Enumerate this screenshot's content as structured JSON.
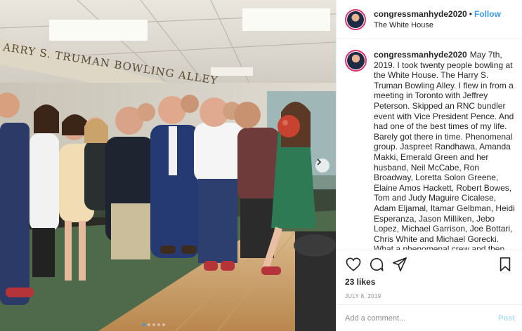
{
  "photo": {
    "sign_text": "ARRY S. TRUMAN BOWLING ALLEY",
    "carousel_count": 5,
    "carousel_active_index": 0,
    "next_icon": "chevron-right-icon"
  },
  "post": {
    "username": "congressmanhyde2020",
    "separator": "•",
    "follow_label": "Follow",
    "location": "The White House",
    "caption": "May 7th, 2019. I took twenty people bowling at the White House. The Harry S. Truman Bowling Alley. I flew in from a meeting in Toronto with Jeffrey Peterson. Skipped an RNC bundler event with Vice President Pence. And had one of the best times of my life. Barely got there in time. Phenomenal group. Jaspreet Randhawa, Amanda Makki, Emerald Green and her husband, Neil McCabe, Ron Broadway, Loretta Solon Greene, Elaine Amos Hackett, Robert Bowes, Tom and Judy Maguire Cicalese, Adam Eljamal, Itamar Gelbman, Heidi Esperanza, Jason Milliken, Jebo Lopez, Michael Garrison, Joe Bottari, Chris White and Michael Gorecki. What a phenomenal crew and then Paul Alphabet bowled a strike.",
    "likes": "23 likes",
    "date": "JULY 8, 2019",
    "icons": [
      "heart-icon",
      "comment-icon",
      "share-icon",
      "bookmark-icon"
    ]
  },
  "comment_box": {
    "placeholder": "Add a comment...",
    "post_label": "Post"
  },
  "colors": {
    "follow": "#3897f0",
    "post_disabled": "#b2dffc",
    "avatar_ring": "#e1306c",
    "muted_text": "#8e8e8e"
  }
}
